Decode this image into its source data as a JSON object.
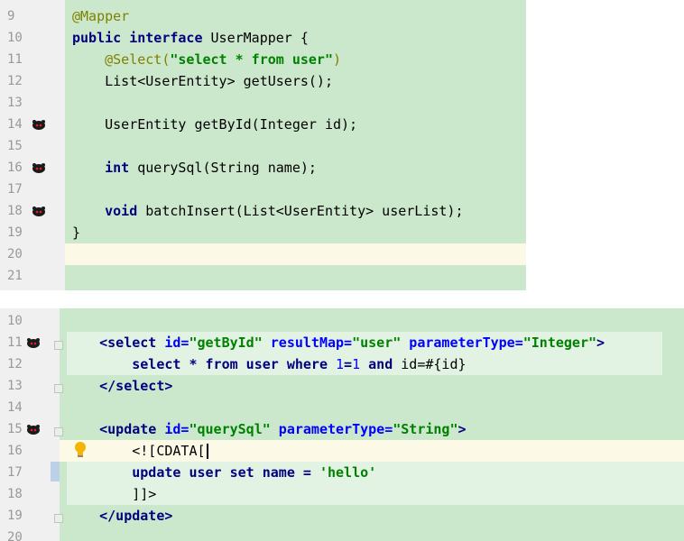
{
  "java_editor": {
    "line_numbers": [
      "9",
      "10",
      "11",
      "12",
      "13",
      "14",
      "15",
      "16",
      "17",
      "18",
      "19",
      "20",
      "21"
    ],
    "bookmarked_lines": [
      "14",
      "16",
      "18"
    ],
    "lines": [
      [
        {
          "t": "@Mapper",
          "c": "ann"
        }
      ],
      [
        {
          "t": "public",
          "c": "kw"
        },
        {
          "t": " ",
          "c": "plain"
        },
        {
          "t": "interface",
          "c": "kw"
        },
        {
          "t": " UserMapper {",
          "c": "plain"
        }
      ],
      [
        {
          "t": "    ",
          "c": "plain"
        },
        {
          "t": "@Select(",
          "c": "ann"
        },
        {
          "t": "\"select * from user\"",
          "c": "str"
        },
        {
          "t": ")",
          "c": "ann"
        }
      ],
      [
        {
          "t": "    List<UserEntity> getUsers();",
          "c": "plain"
        }
      ],
      [],
      [
        {
          "t": "    UserEntity getById(Integer id);",
          "c": "plain"
        }
      ],
      [],
      [
        {
          "t": "    ",
          "c": "plain"
        },
        {
          "t": "int",
          "c": "kw"
        },
        {
          "t": " querySql(String name);",
          "c": "plain"
        }
      ],
      [],
      [
        {
          "t": "    ",
          "c": "plain"
        },
        {
          "t": "void",
          "c": "kw"
        },
        {
          "t": " batchInsert(List<UserEntity> userList);",
          "c": "plain"
        }
      ],
      [
        {
          "t": "}",
          "c": "plain"
        }
      ],
      [],
      []
    ]
  },
  "xml_editor": {
    "line_numbers": [
      "10",
      "11",
      "12",
      "13",
      "14",
      "15",
      "16",
      "17",
      "18",
      "19",
      "20"
    ],
    "bookmarked_lines": [
      "11",
      "15"
    ],
    "lines": [
      [],
      [
        {
          "t": "    ",
          "c": "plain"
        },
        {
          "t": "<select",
          "c": "kw"
        },
        {
          "t": " id=",
          "c": "attr"
        },
        {
          "t": "\"getById\"",
          "c": "str"
        },
        {
          "t": " resultMap=",
          "c": "attr"
        },
        {
          "t": "\"user\"",
          "c": "str"
        },
        {
          "t": " parameterType=",
          "c": "attr"
        },
        {
          "t": "\"Integer\"",
          "c": "str"
        },
        {
          "t": ">",
          "c": "kw"
        }
      ],
      [
        {
          "t": "        select * from user where ",
          "c": "kw"
        },
        {
          "t": "1",
          "c": "num"
        },
        {
          "t": "=",
          "c": "kw"
        },
        {
          "t": "1",
          "c": "num"
        },
        {
          "t": " and ",
          "c": "kw"
        },
        {
          "t": "id=#{id}",
          "c": "plain"
        }
      ],
      [
        {
          "t": "    </select>",
          "c": "kw"
        }
      ],
      [],
      [
        {
          "t": "    ",
          "c": "plain"
        },
        {
          "t": "<update",
          "c": "kw"
        },
        {
          "t": " id=",
          "c": "attr"
        },
        {
          "t": "\"querySql\"",
          "c": "str"
        },
        {
          "t": " parameterType=",
          "c": "attr"
        },
        {
          "t": "\"String\"",
          "c": "str"
        },
        {
          "t": ">",
          "c": "kw"
        }
      ],
      [
        {
          "t": "        <![CDATA[",
          "c": "plain"
        }
      ],
      [
        {
          "t": "        update user set name = ",
          "c": "kw"
        },
        {
          "t": "'hello'",
          "c": "str"
        }
      ],
      [
        {
          "t": "        ]]>",
          "c": "plain"
        }
      ],
      [
        {
          "t": "    </update>",
          "c": "kw"
        }
      ],
      []
    ]
  }
}
